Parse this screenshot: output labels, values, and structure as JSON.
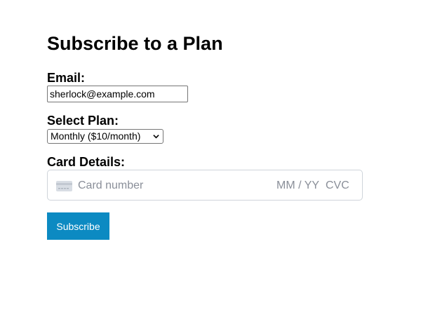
{
  "form": {
    "title": "Subscribe to a Plan",
    "email_label": "Email:",
    "email_value": "sherlock@example.com",
    "plan_label": "Select Plan:",
    "plan_selected": "Monthly ($10/month)",
    "card_label": "Card Details:",
    "card_number_placeholder": "Card number",
    "card_expiry_placeholder": "MM / YY",
    "card_cvc_placeholder": "CVC",
    "submit_label": "Subscribe"
  },
  "icons": {
    "card": "credit-card-icon",
    "select_arrow": "chevron-down-icon"
  },
  "colors": {
    "button_bg": "#0c8ac2",
    "button_text": "#ffffff",
    "placeholder_text": "#8a8f99",
    "card_border": "#cfd4da"
  }
}
